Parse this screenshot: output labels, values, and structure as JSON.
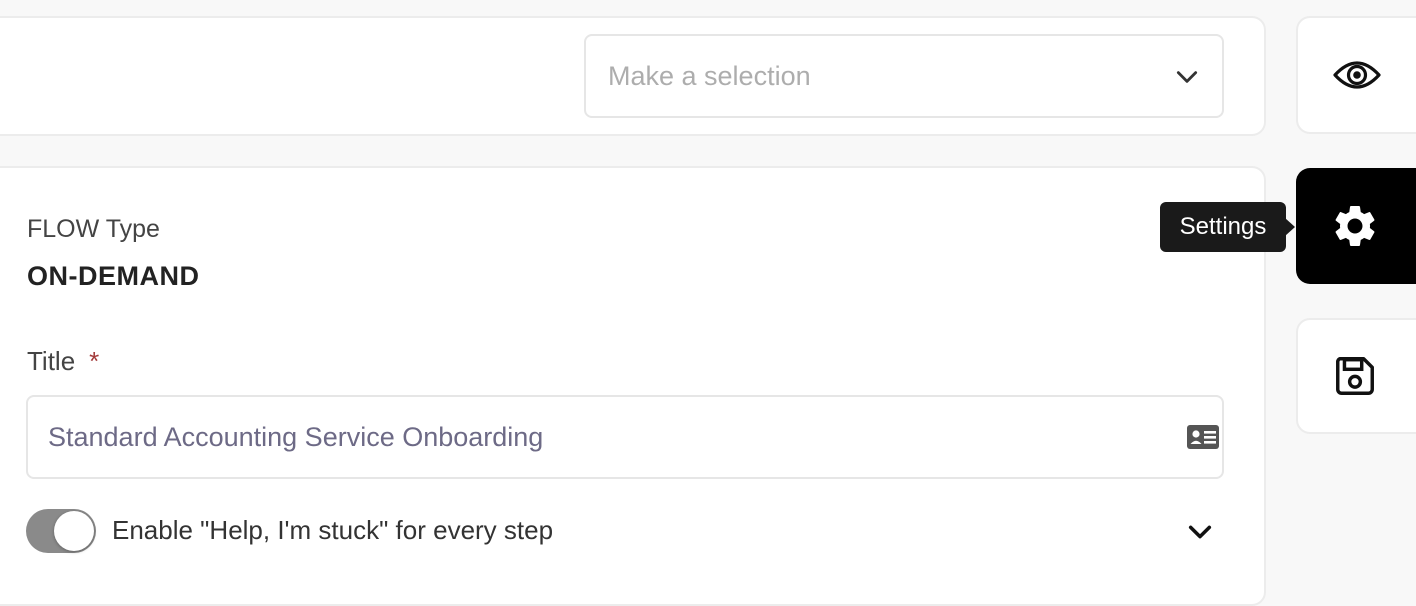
{
  "selection": {
    "placeholder": "Make a selection"
  },
  "flow": {
    "label": "FLOW Type",
    "value": "ON-DEMAND"
  },
  "title_field": {
    "label": "Title",
    "required_marker": "*",
    "value": "Standard Accounting Service Onboarding"
  },
  "help_toggle": {
    "label": "Enable \"Help, I'm stuck\" for every step",
    "enabled": true
  },
  "sidebar": {
    "items": [
      {
        "icon": "eye-icon",
        "active": false
      },
      {
        "icon": "gear-icon",
        "active": true
      },
      {
        "icon": "floppy-disk-icon",
        "active": false
      }
    ],
    "tooltip": "Settings"
  },
  "colors": {
    "background": "#f8f8f8",
    "card": "#ffffff",
    "border": "#ececec",
    "placeholder": "#adadad",
    "input_text": "#6d6a86",
    "required": "#a33a3a",
    "toggle_on": "#8a8a8a",
    "active_button": "#000000",
    "tooltip_bg": "#1a1a1a"
  }
}
